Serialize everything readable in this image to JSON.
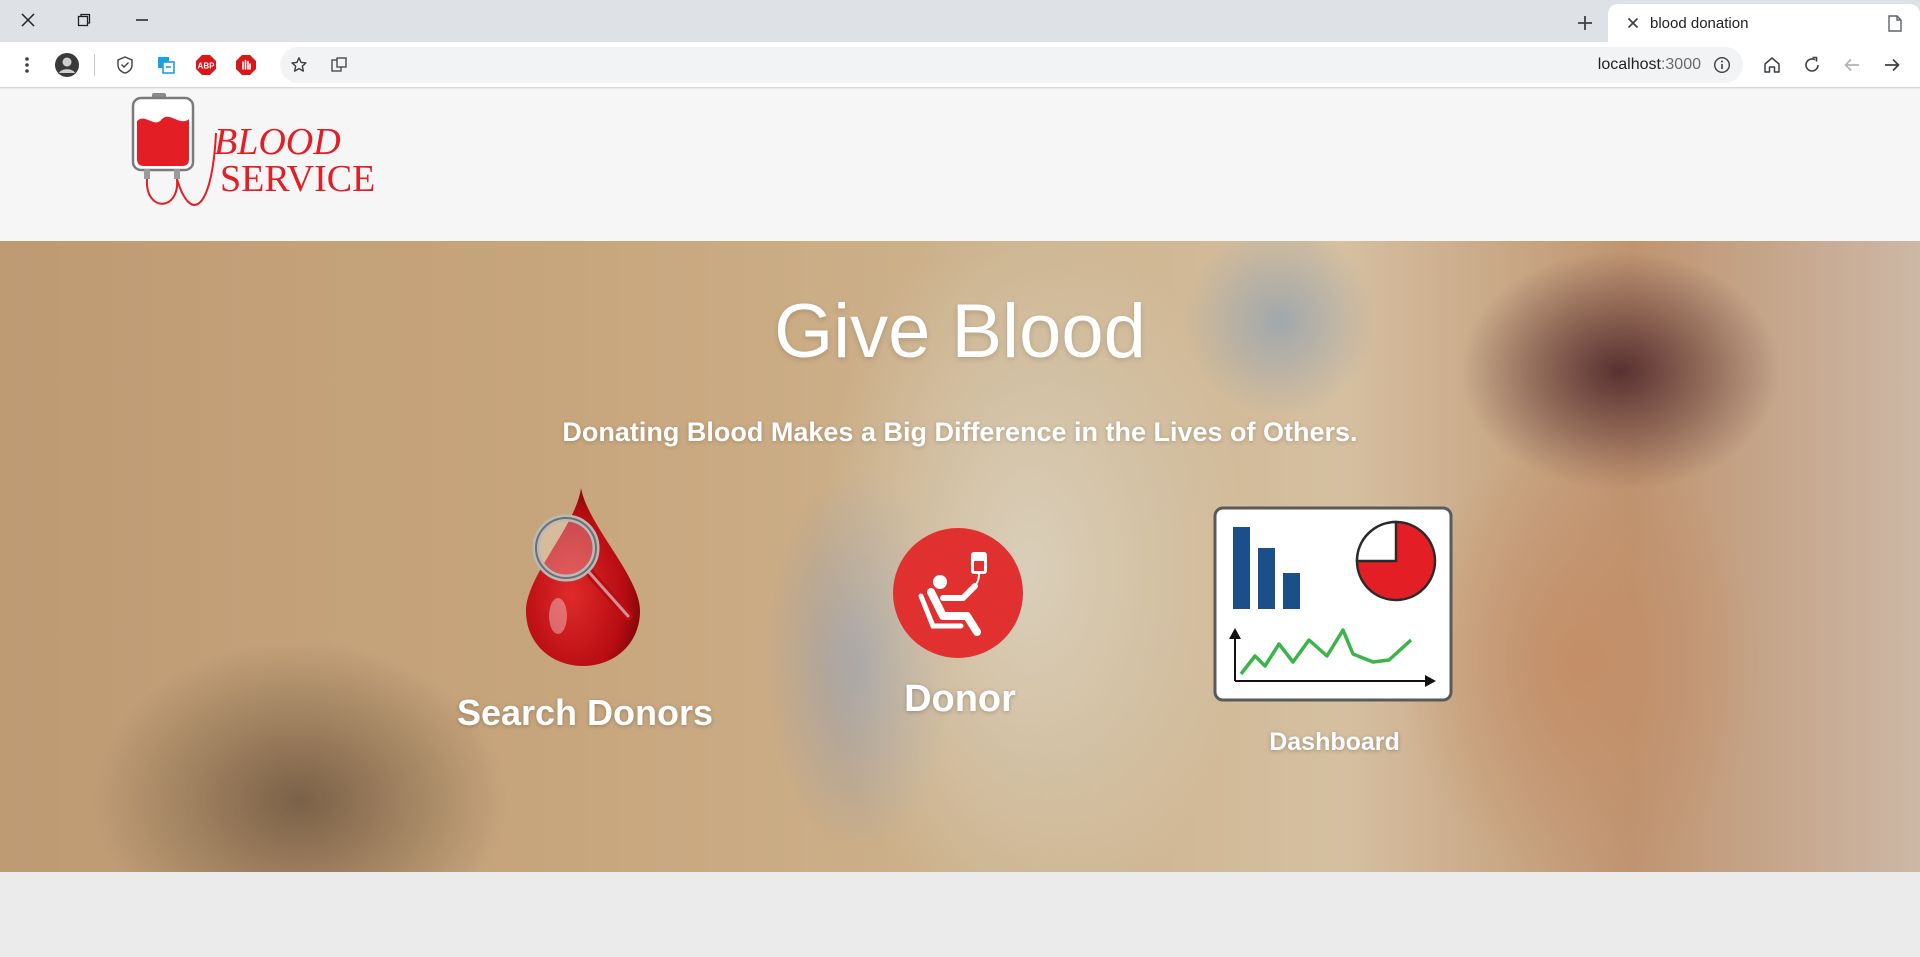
{
  "browser": {
    "tab_title": "blood donation",
    "url_host": "localhost",
    "url_port": ":3000"
  },
  "logo": {
    "line1": "BLOOD",
    "line2": "SERVICE"
  },
  "hero": {
    "title": "Give Blood",
    "subtitle": "Donating Blood Makes a Big Difference in the Lives of Others."
  },
  "features": {
    "search_label": "Search Donors",
    "donor_label": "Donor",
    "dashboard_label": "Dashboard"
  },
  "colors": {
    "brand_red": "#e31e24",
    "chart_blue": "#1b4f8a",
    "chart_green": "#3bb44a"
  }
}
